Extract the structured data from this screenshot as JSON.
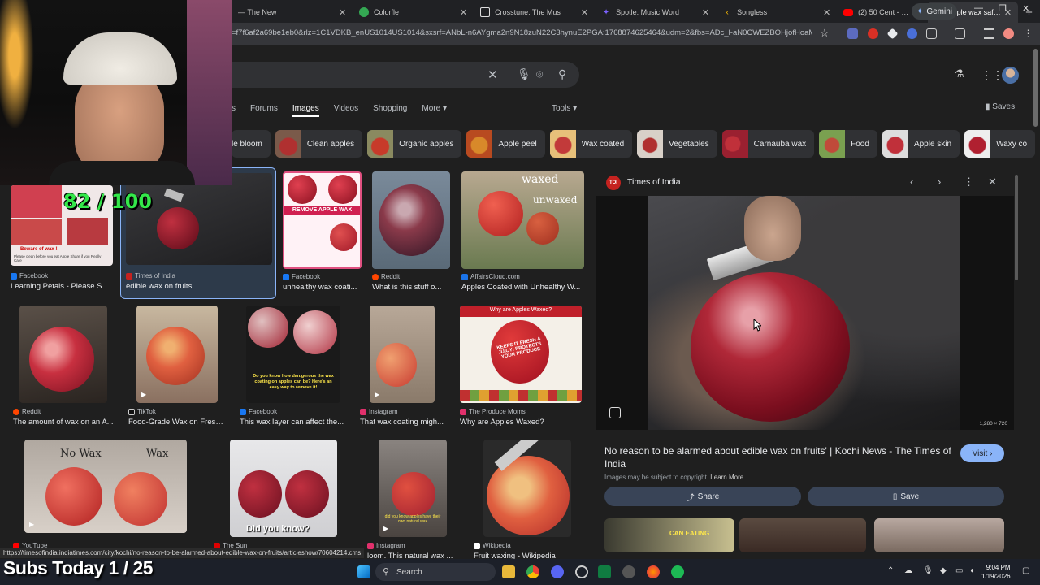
{
  "browser": {
    "tabs": [
      {
        "title": "— The New",
        "icon_color": "#9aa0a6"
      },
      {
        "title": "Colorfle",
        "icon_color": "#34a853"
      },
      {
        "title": "Crosstune: The Mus",
        "icon_color": "#e8eaed"
      },
      {
        "title": "Spotle: Music Word",
        "icon_color": "#7b61ff"
      },
      {
        "title": "Songless",
        "icon_color": "#fbbc04"
      },
      {
        "title": "(2) 50 Cent - 21 Qu",
        "icon_color": "#ff0000"
      },
      {
        "title": "apple wax safe to e",
        "icon_color": "#4285f4"
      }
    ],
    "gemini_label": "Gemini",
    "url": "=f7f6af2a69be1eb0&rlz=1C1VDKB_enUS1014US1014&sxsrf=ANbL-n6AYgma2n9N18zuN22C3hynuE2PGA:1768874625464&udm=2&fbs=ADc_l-aN0CWEZBOHjofHoaMMDi...",
    "status_url": "https://timesofindia.indiatimes.com/city/kochi/no-reason-to-be-alarmed-about-edible-wax-on-fruits/articleshow/70604214.cms"
  },
  "search": {
    "nav_tabs": [
      "s",
      "Forums",
      "Images",
      "Videos",
      "Shopping",
      "More"
    ],
    "active_tab": "Images",
    "tools_label": "Tools",
    "saves_label": "Saves",
    "chips": [
      "le bloom",
      "Clean apples",
      "Organic apples",
      "Apple peel",
      "Wax coated",
      "Vegetables",
      "Carnauba wax",
      "Food",
      "Apple skin",
      "Waxy co"
    ]
  },
  "results": [
    {
      "source": "Facebook",
      "title": "Learning Petals - Please S..."
    },
    {
      "source": "Times of India",
      "title": "edible wax on fruits ..."
    },
    {
      "source": "Facebook",
      "title": "unhealthy wax coati..."
    },
    {
      "source": "Reddit",
      "title": "What is this stuff o..."
    },
    {
      "source": "AffairsCloud.com",
      "title": "Apples Coated with Unhealthy W..."
    },
    {
      "source": "Reddit",
      "title": "The amount of wax on an A..."
    },
    {
      "source": "TikTok",
      "title": "Food-Grade Wax on Fresh..."
    },
    {
      "source": "Facebook",
      "title": "This wax layer can affect the..."
    },
    {
      "source": "Instagram",
      "title": "That wax coating migh..."
    },
    {
      "source": "The Produce Moms",
      "title": "Why are Apples Waxed?"
    },
    {
      "source": "YouTube",
      "title": ""
    },
    {
      "source": "The Sun",
      "title": ""
    },
    {
      "source": "Instagram",
      "title": "loom. This natural wax ..."
    },
    {
      "source": "Wikipedia",
      "title": "Fruit waxing - Wikipedia"
    }
  ],
  "thumb_text": {
    "fb1_top": "Beware of wax !!",
    "fb1_bottom": "Please clean before you eat Apple Share if you Really Care",
    "fb2_title": "REMOVE APPLE WAX",
    "affairs_top": "waxed",
    "affairs_bottom": "unwaxed",
    "fb3_caption": "Do you know how dan.gerous the wax coating on apples can be? Here's an easy way to remove it!",
    "producemoms_top": "Why are Apples Waxed?",
    "producemoms_badge": "KEEPS IT FRESH & JUICY! PROTECTS YOUR PRODUCE",
    "yt_left": "No Wax",
    "yt_right": "Wax",
    "sun_caption": "Did you know?",
    "insta_caption": "did you know apples have their own natural wax",
    "selected_img_score_hidden": ""
  },
  "preview": {
    "source": "Times of India",
    "resolution": "1,280 × 720",
    "title": "No reason to be alarmed about edible wax on fruits' | Kochi News - The Times of India",
    "visit_label": "Visit",
    "copyright": "Images may be subject to copyright.",
    "learn_more": "Learn More",
    "share_label": "Share",
    "save_label": "Save",
    "related_caption": "CAN EATING"
  },
  "taskbar": {
    "search_label": "Search",
    "time": "9:04 PM",
    "date": "1/19/2026"
  },
  "overlay": {
    "score": "82 / 100",
    "subs": "Subs Today  1 / 25"
  }
}
